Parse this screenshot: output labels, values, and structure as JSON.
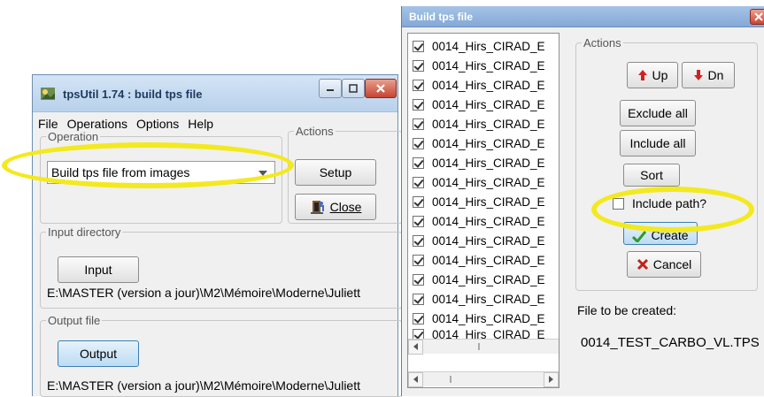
{
  "left_window": {
    "title": "tpsUtil 1.74 : build tps file",
    "menu": [
      "File",
      "Operations",
      "Options",
      "Help"
    ],
    "operation": {
      "legend": "Operation",
      "selected": "Build tps file from images"
    },
    "actions": {
      "legend": "Actions",
      "setup_label": "Setup",
      "close_label": "Close"
    },
    "input": {
      "legend": "Input directory",
      "button_label": "Input",
      "path": "E:\\MASTER (version a jour)\\M2\\Mémoire\\Moderne\\Juliett"
    },
    "output": {
      "legend": "Output file",
      "button_label": "Output",
      "path": "E:\\MASTER (version a jour)\\M2\\Mémoire\\Moderne\\Juliett"
    }
  },
  "right_window": {
    "title": "Build tps file",
    "files": [
      "0014_Hirs_CIRAD_E",
      "0014_Hirs_CIRAD_E",
      "0014_Hirs_CIRAD_E",
      "0014_Hirs_CIRAD_E",
      "0014_Hirs_CIRAD_E",
      "0014_Hirs_CIRAD_E",
      "0014_Hirs_CIRAD_E",
      "0014_Hirs_CIRAD_E",
      "0014_Hirs_CIRAD_E",
      "0014_Hirs_CIRAD_E",
      "0014_Hirs_CIRAD_E",
      "0014_Hirs_CIRAD_E",
      "0014_Hirs_CIRAD_E",
      "0014_Hirs_CIRAD_E",
      "0014_Hirs_CIRAD_E",
      "0014_Hirs_CIRAD_E"
    ],
    "actions": {
      "legend": "Actions",
      "up_label": "Up",
      "dn_label": "Dn",
      "exclude_all_label": "Exclude all",
      "include_all_label": "Include all",
      "sort_label": "Sort",
      "include_path_label": "Include path?",
      "create_label": "Create",
      "cancel_label": "Cancel"
    },
    "file_to_create_label": "File to be created:",
    "file_to_create_value": "0014_TEST_CARBO_VL.TPS"
  },
  "colors": {
    "highlight": "#f3e91f",
    "close_red": "#cc4632",
    "up_red": "#d32020",
    "check_green": "#2e9a2e",
    "cancel_red": "#c0221a"
  }
}
